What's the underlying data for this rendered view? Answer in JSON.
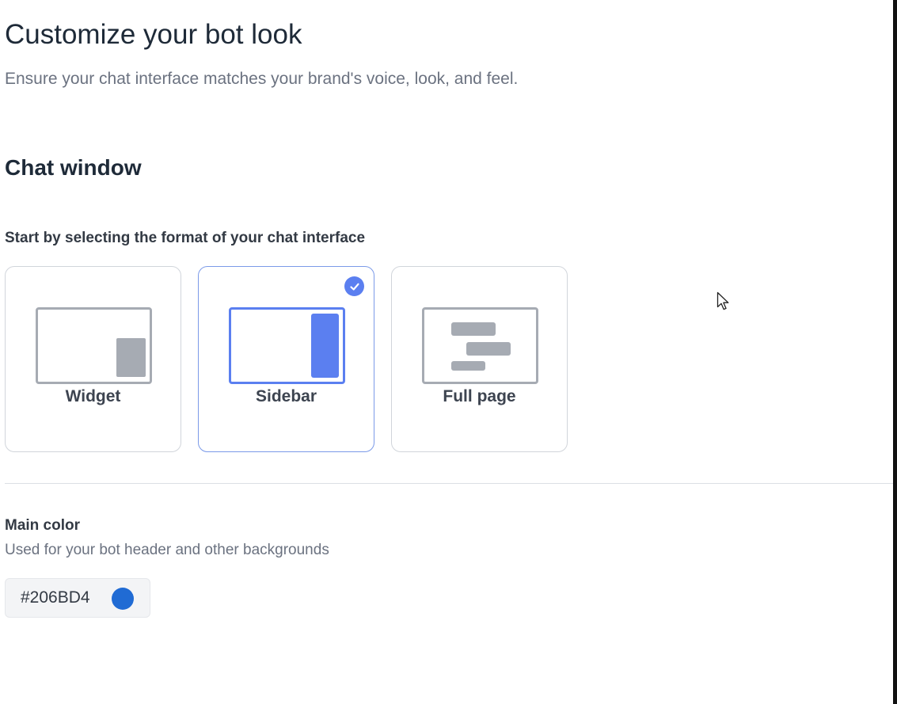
{
  "header": {
    "title": "Customize your bot look",
    "subtitle": "Ensure your chat interface matches your brand's voice, look, and feel."
  },
  "chat_window": {
    "section_title": "Chat window",
    "prompt": "Start by selecting the format of your chat interface",
    "formats": [
      {
        "label": "Widget",
        "selected": false,
        "icon": "widget-layout-icon"
      },
      {
        "label": "Sidebar",
        "selected": true,
        "icon": "sidebar-layout-icon"
      },
      {
        "label": "Full page",
        "selected": false,
        "icon": "full-page-layout-icon"
      }
    ],
    "selected_badge_icon": "checkmark-icon"
  },
  "main_color": {
    "label": "Main color",
    "help": "Used for your bot header and other backgrounds",
    "value": "#206BD4",
    "swatch": "#206BD4"
  },
  "colors": {
    "accent": "#5B7FF0",
    "inactive_preview": "#A6ABB3",
    "selected_border": "#7B9AE8",
    "card_border": "#D1D5DB"
  },
  "pointer": {
    "icon": "mouse-pointer-icon"
  }
}
